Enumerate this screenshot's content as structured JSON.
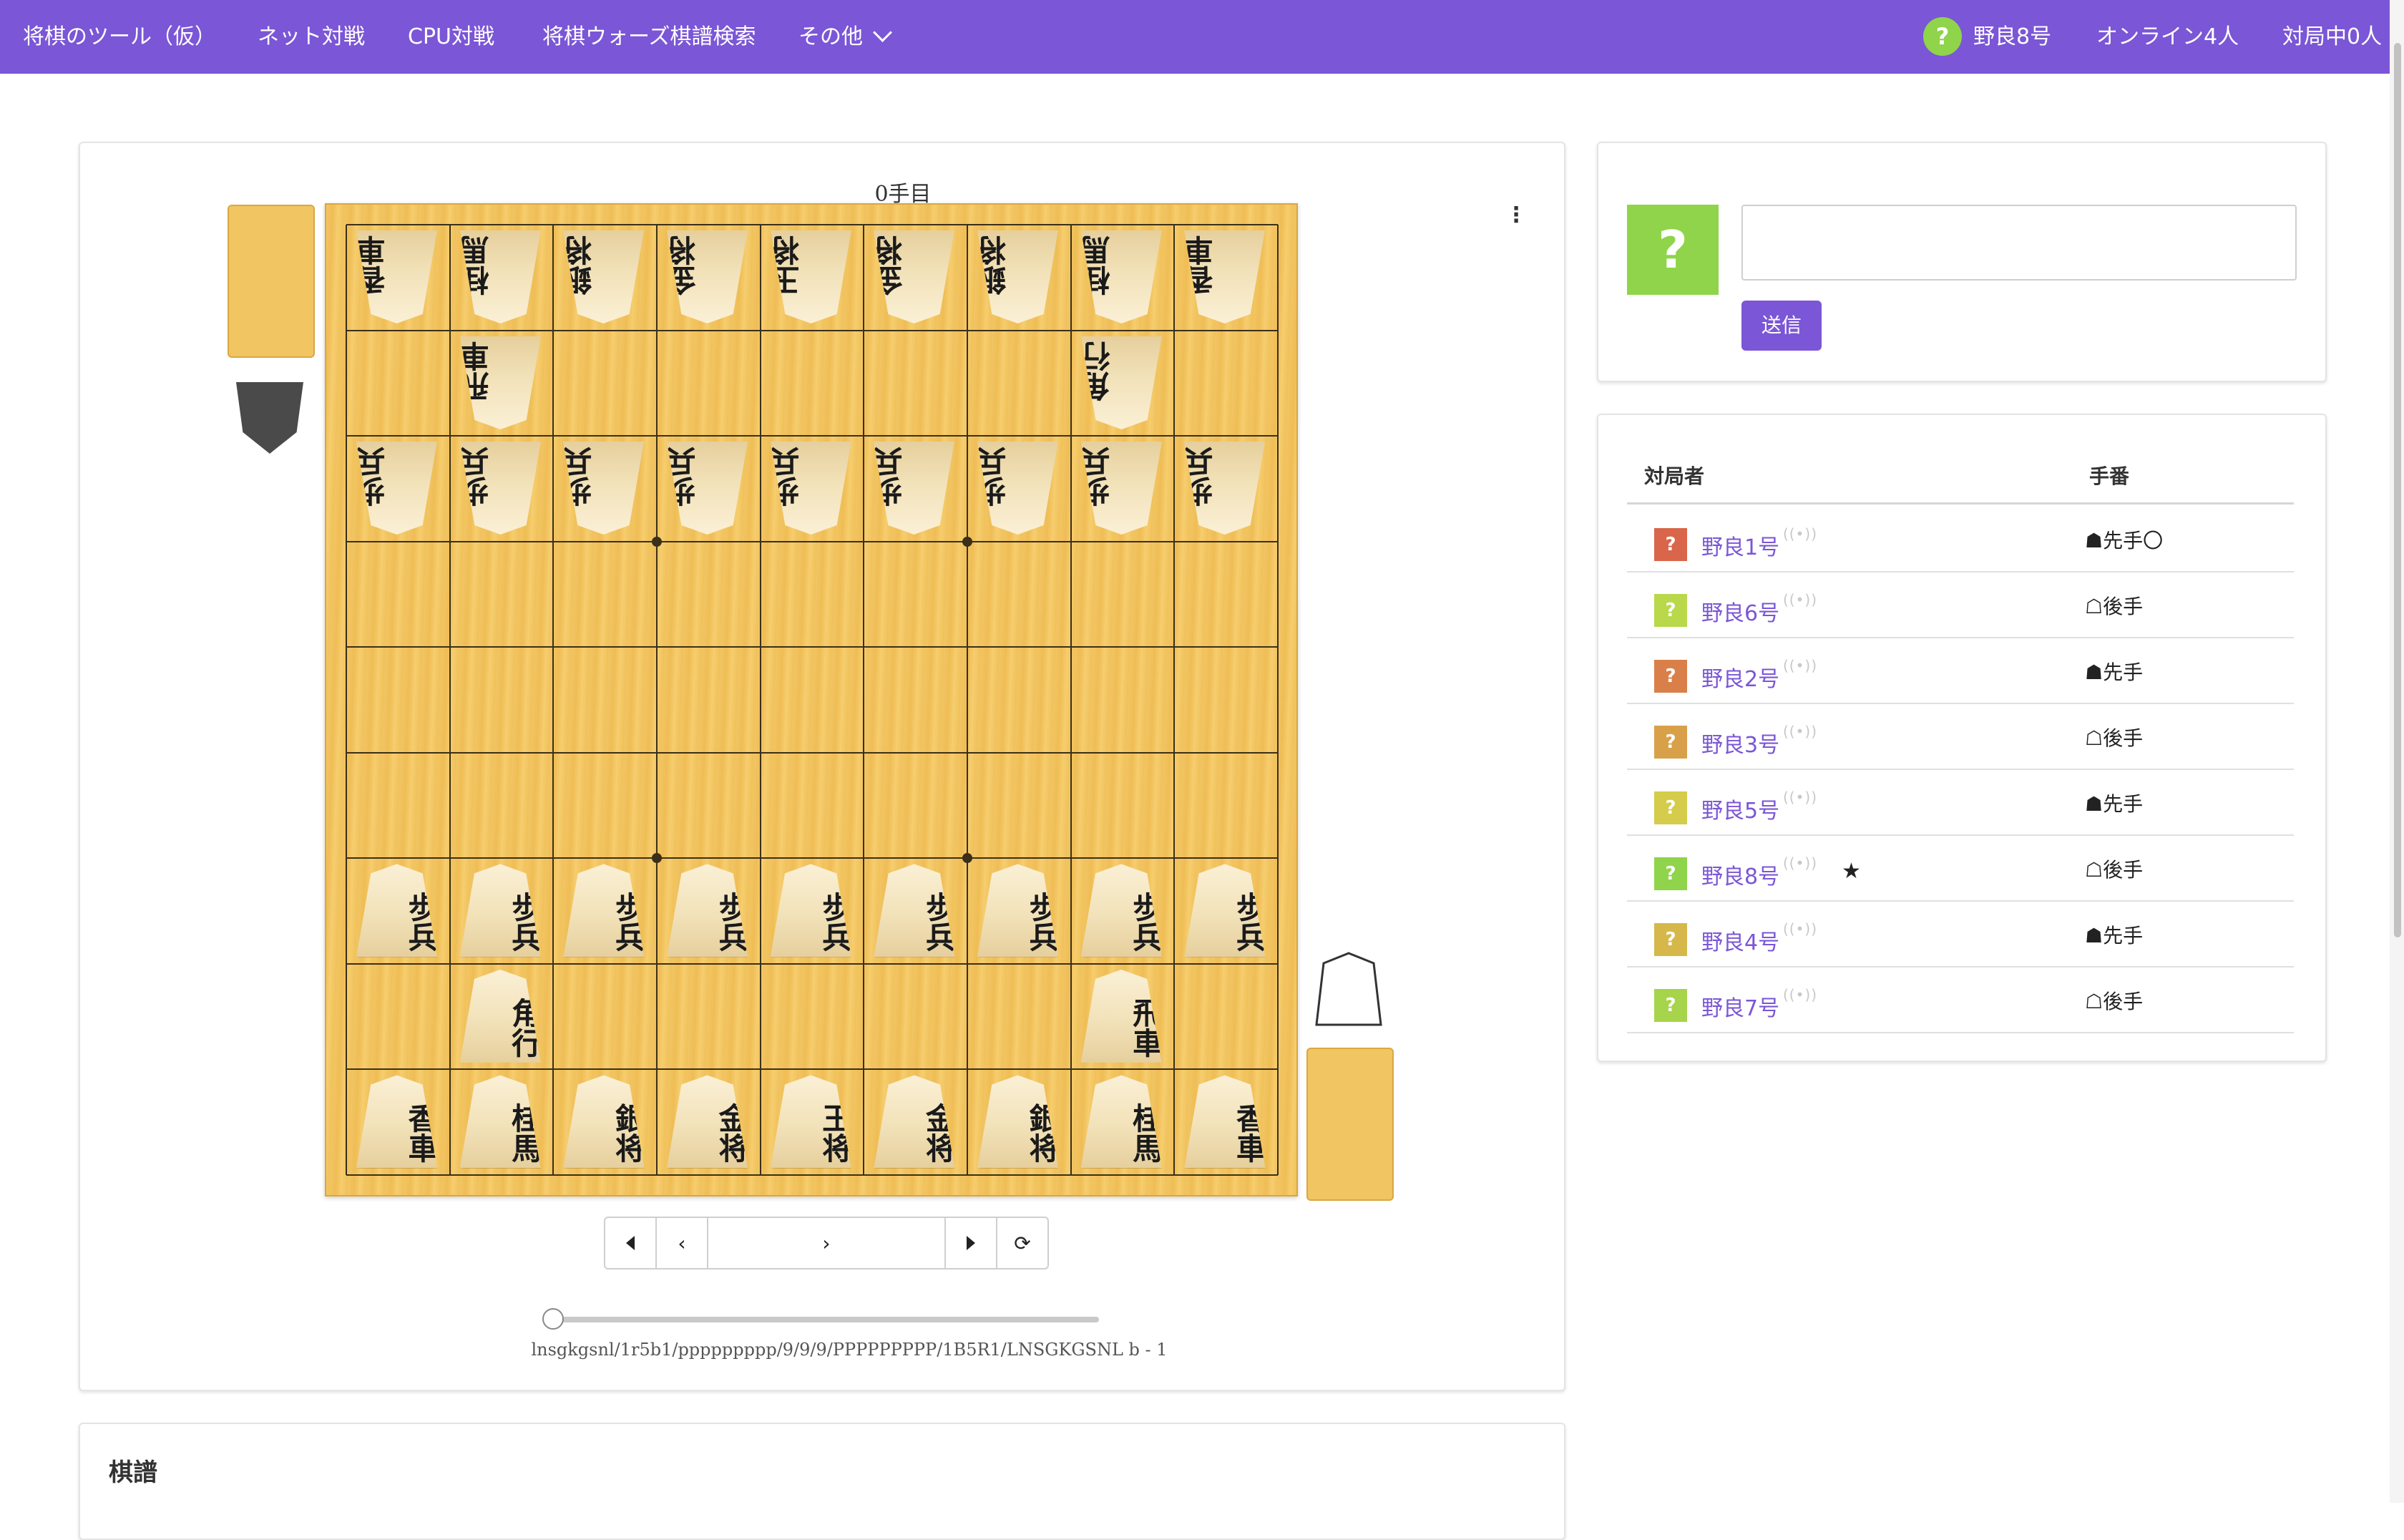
{
  "nav": {
    "brand": "将棋のツール（仮）",
    "items": [
      "ネット対戦",
      "CPU対戦",
      "将棋ウォーズ棋譜検索",
      "その他"
    ],
    "user_avatar": "?",
    "user_name": "野良8号",
    "online": "オンライン4人",
    "playing": "対局中0人",
    "accent_color": "#7b56d6"
  },
  "board": {
    "move_count": "0手目",
    "menu_icon": "⋮",
    "rows": [
      [
        "香車",
        "桂馬",
        "銀将",
        "金将",
        "玉将",
        "金将",
        "銀将",
        "桂馬",
        "香車"
      ],
      [
        "",
        "飛車",
        "",
        "",
        "",
        "",
        "",
        "角行",
        ""
      ],
      [
        "歩兵",
        "歩兵",
        "歩兵",
        "歩兵",
        "歩兵",
        "歩兵",
        "歩兵",
        "歩兵",
        "歩兵"
      ],
      [
        "",
        "",
        "",
        "",
        "",
        "",
        "",
        "",
        ""
      ],
      [
        "",
        "",
        "",
        "",
        "",
        "",
        "",
        "",
        ""
      ],
      [
        "",
        "",
        "",
        "",
        "",
        "",
        "",
        "",
        ""
      ],
      [
        "歩兵",
        "歩兵",
        "歩兵",
        "歩兵",
        "歩兵",
        "歩兵",
        "歩兵",
        "歩兵",
        "歩兵"
      ],
      [
        "",
        "角行",
        "",
        "",
        "",
        "",
        "",
        "飛車",
        ""
      ],
      [
        "香車",
        "桂馬",
        "銀将",
        "金将",
        "王将",
        "金将",
        "銀将",
        "桂馬",
        "香車"
      ]
    ],
    "controls": [
      "first-icon",
      "prev-icon",
      "next-icon",
      "last-icon",
      "flip-icon"
    ],
    "ply_slider_value": 0,
    "sfen": "lnsgkgsnl/1r5b1/ppppppppp/9/9/9/PPPPPPPPP/1B5R1/LNSGKGSNL b - 1"
  },
  "chat": {
    "avatar": "?",
    "input_value": "",
    "send_label": "送信"
  },
  "players": {
    "header_player": "対局者",
    "header_turn": "手番",
    "rows": [
      {
        "avatar": "?",
        "color": "#d9654a",
        "name": "野良1号",
        "conn": "((•))",
        "star": "",
        "turn": "☗先手〇"
      },
      {
        "avatar": "?",
        "color": "#b9d84a",
        "name": "野良6号",
        "conn": "((•))",
        "star": "",
        "turn": "☖後手"
      },
      {
        "avatar": "?",
        "color": "#d9804a",
        "name": "野良2号",
        "conn": "((•))",
        "star": "",
        "turn": "☗先手"
      },
      {
        "avatar": "?",
        "color": "#d9a04a",
        "name": "野良3号",
        "conn": "((•))",
        "star": "",
        "turn": "☖後手"
      },
      {
        "avatar": "?",
        "color": "#d4cc4a",
        "name": "野良5号",
        "conn": "((•))",
        "star": "",
        "turn": "☗先手"
      },
      {
        "avatar": "?",
        "color": "#8fd44a",
        "name": "野良8号",
        "conn": "((•))",
        "star": "★",
        "turn": "☖後手"
      },
      {
        "avatar": "?",
        "color": "#d6b84a",
        "name": "野良4号",
        "conn": "((•))",
        "star": "",
        "turn": "☗先手"
      },
      {
        "avatar": "?",
        "color": "#a6d44a",
        "name": "野良7号",
        "conn": "((•))",
        "star": "",
        "turn": "☖後手"
      }
    ]
  },
  "kifu": {
    "title": "棋譜"
  }
}
